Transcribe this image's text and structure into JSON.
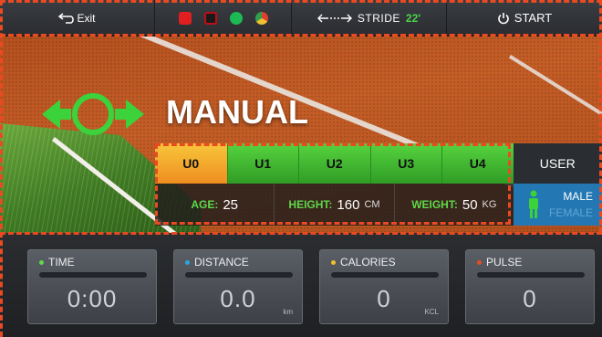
{
  "topbar": {
    "exit_label": "Exit",
    "apps": [
      {
        "name": "youtube-icon",
        "color": "#e02020"
      },
      {
        "name": "netflix-icon",
        "color": "#c10e14"
      },
      {
        "name": "spotify-icon",
        "color": "#1db954"
      },
      {
        "name": "chrome-icon",
        "color": "#e9a92a"
      }
    ],
    "stride_label": "STRIDE",
    "stride_value": "22'",
    "start_label": "START"
  },
  "hero": {
    "mode_title": "MANUAL"
  },
  "users": {
    "tabs": [
      "U0",
      "U1",
      "U2",
      "U3",
      "U4"
    ],
    "active_tab": "U0",
    "user_label": "USER",
    "age_label": "AGE:",
    "age_value": "25",
    "height_label": "HEIGHT:",
    "height_value": "160",
    "height_unit": "CM",
    "weight_label": "WEIGHT:",
    "weight_value": "50",
    "weight_unit": "KG",
    "gender_male": "MALE",
    "gender_female": "FEMALE"
  },
  "stats": [
    {
      "label": "TIME",
      "value": "0:00",
      "unit": "",
      "dot_color": "#5fd84a"
    },
    {
      "label": "DISTANCE",
      "value": "0.0",
      "unit": "km",
      "dot_color": "#2aa8d8"
    },
    {
      "label": "CALORIES",
      "value": "0",
      "unit": "KCL",
      "dot_color": "#f0c030"
    },
    {
      "label": "PULSE",
      "value": "0",
      "unit": "",
      "dot_color": "#e0502a"
    }
  ],
  "colors": {
    "accent_green": "#5fd84a",
    "accent_orange": "#ef8e20",
    "overlay_dash": "#ea4a22"
  }
}
